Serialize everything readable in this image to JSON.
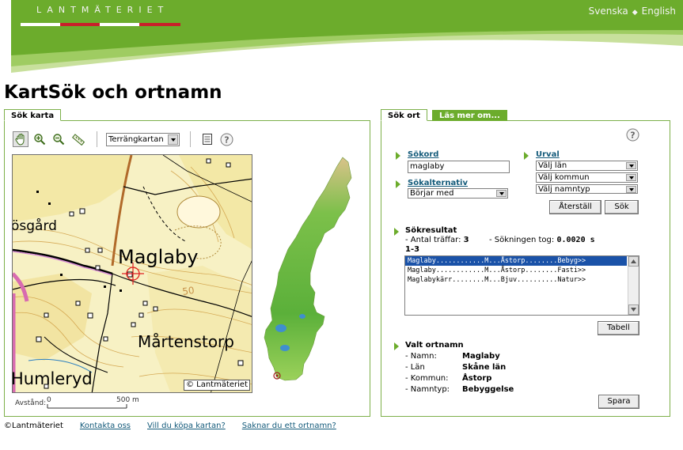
{
  "header": {
    "brand": "LANTMÄTERIET",
    "lang_sv": "Svenska",
    "lang_sep": "◆",
    "lang_en": "English"
  },
  "page_title": "KartSök och ortnamn",
  "tabs": {
    "map": "Sök karta",
    "search": "Sök ort",
    "more": "Läs mer om..."
  },
  "map": {
    "map_type": "Terrängkartan",
    "places": [
      "ösgård",
      "Maglaby",
      "Mårtenstorp",
      "Humleryd"
    ],
    "contour_value": "50",
    "copyright": "© Lantmäteriet",
    "scale_label": "Avstånd:",
    "scale_start": "0",
    "scale_end": "500 m"
  },
  "search": {
    "label_word": "Sökord",
    "word_value": "maglaby",
    "label_alt": "Sökalternativ",
    "alt_value": "Börjar med",
    "label_selection": "Urval",
    "county": "Välj län",
    "municipality": "Välj kommun",
    "name_type": "Välj namntyp",
    "reset_button": "Återställ",
    "search_button": "Sök"
  },
  "results": {
    "title": "Sökresultat",
    "hits_label": "- Antal träffar:",
    "hits_value": "3",
    "time_label": "- Sökningen tog:",
    "time_value": "0.0020 s",
    "range": "1-3",
    "rows": [
      "Maglaby............M...Åstorp........Bebyg>>",
      "Maglaby............M...Åstorp........Fasti>>",
      "Maglabykärr........M...Bjuv..........Natur>>"
    ],
    "table_button": "Tabell"
  },
  "selected": {
    "title": "Valt ortnamn",
    "fields": [
      {
        "k": "- Namn:",
        "v": "Maglaby"
      },
      {
        "k": "- Län",
        "v": "Skåne län"
      },
      {
        "k": "- Kommun:",
        "v": "Åstorp"
      },
      {
        "k": "- Namntyp:",
        "v": "Bebyggelse"
      }
    ],
    "save_button": "Spara"
  },
  "footer": {
    "copyright": "©Lantmäteriet",
    "links": [
      "Kontakta oss",
      "Vill du köpa kartan?",
      "Saknar du ett ortnamn?"
    ]
  },
  "colors": {
    "header_green": "#6cac2c",
    "light_green": "#c8e09c",
    "panel_border": "#7db04a",
    "link_blue": "#135a7a",
    "selection_blue": "#1a52a8",
    "brand_red": "#c8202a"
  },
  "icons": [
    "pan-icon",
    "zoom-in-icon",
    "zoom-out-icon",
    "measure-icon",
    "legend-icon",
    "help-icon"
  ]
}
